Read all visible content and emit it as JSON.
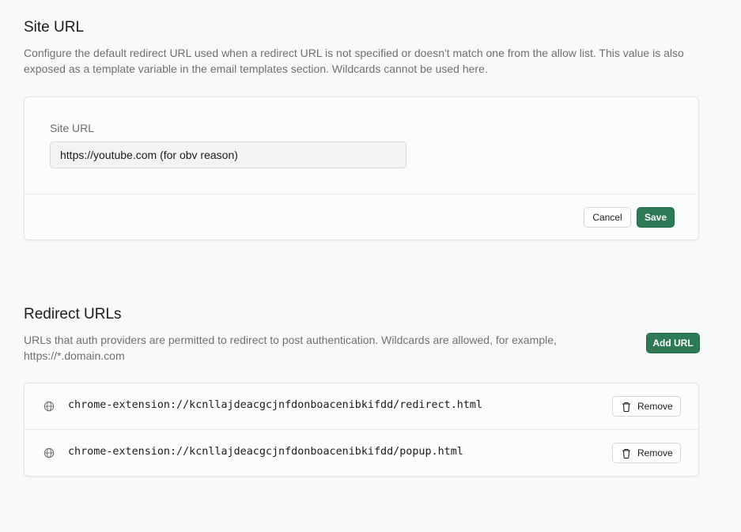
{
  "site_url": {
    "title": "Site URL",
    "description_line1": "Configure the default redirect URL used when a redirect URL is not specified or doesn't match one from the allow list. This value is also",
    "description_line2": "exposed as a template variable in the email templates section. Wildcards cannot be used here.",
    "field_label": "Site URL",
    "field_value": "https://youtube.com (for obv reason)",
    "cancel_label": "Cancel",
    "save_label": "Save"
  },
  "redirect_urls": {
    "title": "Redirect URLs",
    "description_line1": "URLs that auth providers are permitted to redirect to post authentication. Wildcards are allowed, for example,",
    "description_line2": "https://*.domain.com",
    "add_label": "Add URL",
    "items": [
      {
        "url": "chrome-extension://kcnllajdeacgcjnfdonboacenibkifdd/redirect.html",
        "icon": "globe-icon",
        "remove_label": "Remove"
      },
      {
        "url": "chrome-extension://kcnllajdeacgcjnfdonboacenibkifdd/popup.html",
        "icon": "globe-icon",
        "remove_label": "Remove"
      }
    ]
  },
  "colors": {
    "primary": "#2d7a55",
    "background": "#f8f9fa",
    "muted_text": "#707070"
  }
}
